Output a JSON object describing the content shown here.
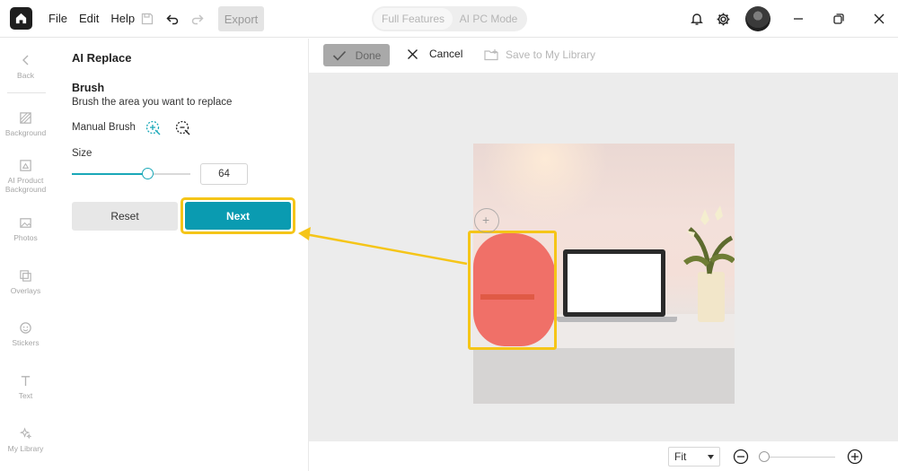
{
  "menu": {
    "file": "File",
    "edit": "Edit",
    "help": "Help"
  },
  "toolbar": {
    "export_label": "Export"
  },
  "mode_toggle": {
    "full_features": "Full Features",
    "ai_pc_mode": "AI PC Mode"
  },
  "rail": {
    "back": "Back",
    "items": [
      {
        "label": "Background",
        "icon": "background-icon"
      },
      {
        "label": "AI Product Background",
        "icon": "ai-product-background-icon"
      },
      {
        "label": "Photos",
        "icon": "photos-icon"
      },
      {
        "label": "Overlays",
        "icon": "overlays-icon"
      },
      {
        "label": "Stickers",
        "icon": "stickers-icon"
      },
      {
        "label": "Text",
        "icon": "text-icon"
      },
      {
        "label": "My Library",
        "icon": "my-library-icon"
      }
    ]
  },
  "panel": {
    "title": "AI Replace",
    "brush_heading": "Brush",
    "brush_desc": "Brush the area you want to replace",
    "manual_brush": "Manual Brush",
    "size_label": "Size",
    "size_value": "64",
    "size_fraction": 0.64,
    "reset_label": "Reset",
    "next_label": "Next"
  },
  "edit_bar": {
    "done": "Done",
    "cancel": "Cancel",
    "save_to_library": "Save to My Library"
  },
  "bottom_bar": {
    "fit_value": "Fit"
  },
  "colors": {
    "accent": "#0a9bb1",
    "highlight": "#f5c518",
    "brush": "#f07068"
  }
}
